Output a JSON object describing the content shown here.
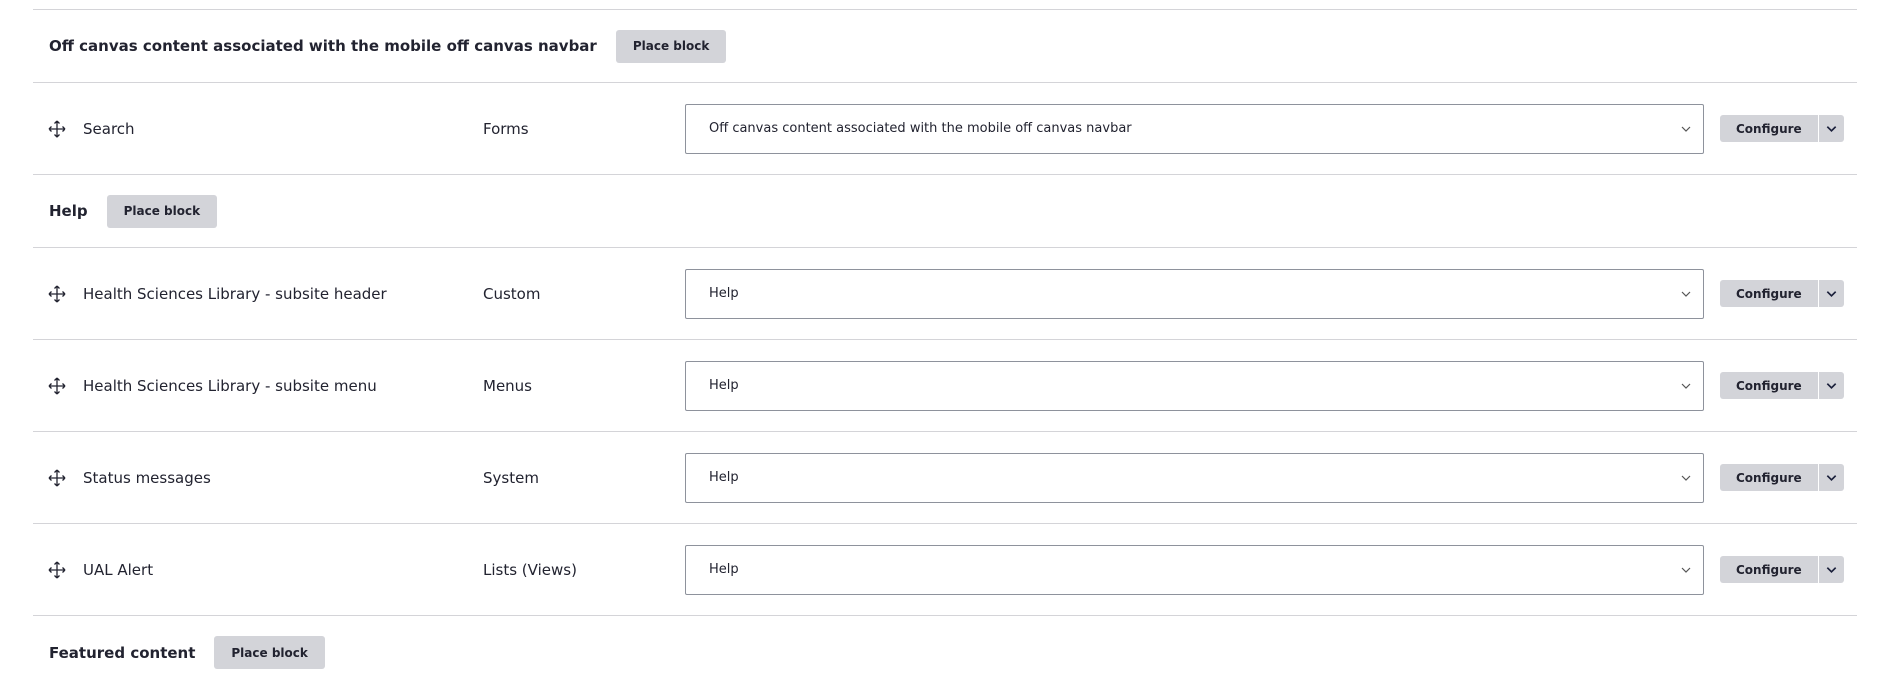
{
  "regions": [
    {
      "title": "Off canvas content associated with the mobile off canvas navbar",
      "place_label": "Place block",
      "blocks": [
        {
          "name": "Search",
          "category": "Forms",
          "region": "Off canvas content associated with the mobile off canvas navbar",
          "configure": "Configure"
        }
      ]
    },
    {
      "title": "Help",
      "place_label": "Place block",
      "blocks": [
        {
          "name": "Health Sciences Library - subsite header",
          "category": "Custom",
          "region": "Help",
          "configure": "Configure"
        },
        {
          "name": "Health Sciences Library - subsite menu",
          "category": "Menus",
          "region": "Help",
          "configure": "Configure"
        },
        {
          "name": "Status messages",
          "category": "System",
          "region": "Help",
          "configure": "Configure"
        },
        {
          "name": "UAL Alert",
          "category": "Lists (Views)",
          "region": "Help",
          "configure": "Configure"
        }
      ]
    },
    {
      "title": "Featured content",
      "place_label": "Place block",
      "blocks": []
    }
  ],
  "icons": {
    "drag": "move-arrows-icon",
    "select": "chevron-down-icon",
    "dropdown": "chevron-down-icon"
  }
}
